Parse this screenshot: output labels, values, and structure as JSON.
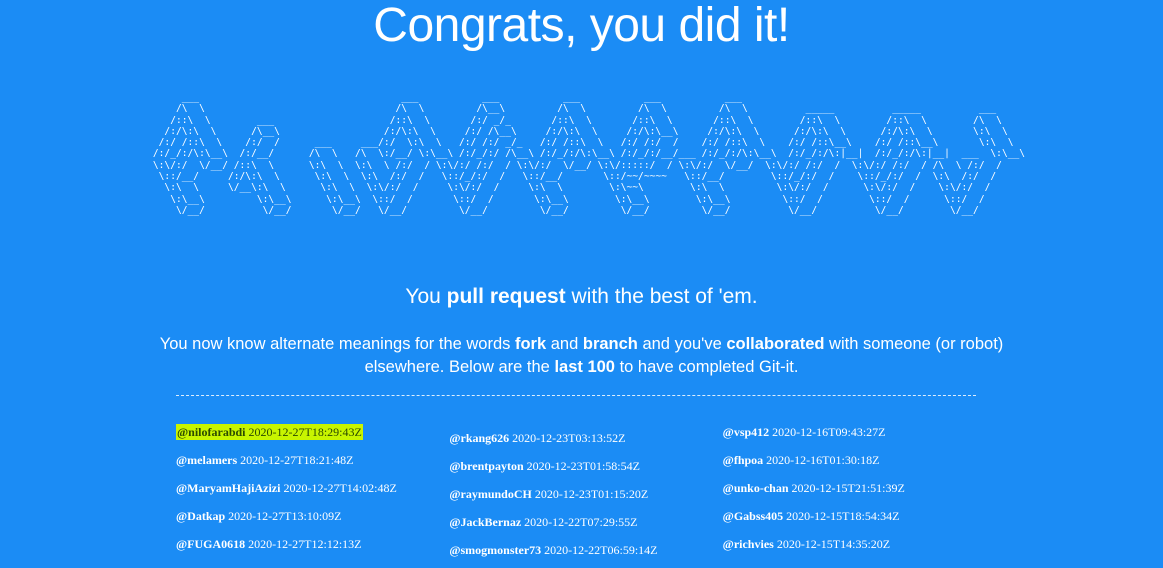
{
  "page": {
    "title": "Congrats, you did it!",
    "ascii_art": "          ___                                   ___           ___           ___           ___           ___                                          \n         /\\  \\                                 /\\  \\         /\\__\\         /\\  \\         /\\  \\         /\\  \\          _____          _____          ___   \n        /::\\  \\        ___                    /::\\  \\       /:/ _/_       /::\\  \\       /::\\  \\       /::\\  \\        /::\\  \\        /::\\  \\        /\\  \\  \n       /:/\\:\\  \\      /\\__\\                  /:/\\:\\  \\     /:/ /\\__\\     /:/\\:\\  \\     /:/\\:\\__\\     /:/\\:\\  \\      /:/\\:\\  \\      /:/\\:\\  \\       \\:\\  \\ \n      /:/ /::\\  \\    /:/  /      ___     ___/:/  \\:\\  \\   /:/ /:/ _/_   /:/ /::\\  \\   /:/ /:/  /    /:/ /::\\  \\    /:/ /::\\__\\    /:/ /::\\__\\       \\:\\  \\\n     /:/_/:/\\:\\__\\  /:/__/      /\\  \\   /\\  \\:/__/ \\:\\__\\ /:/_/:/ /\\__\\ /:/_/:/\\:\\__\\ /:/_/:/__/___ /:/_/:/\\:\\__\\  /:/_/:/\\:|__|  /:/_/:/\\:|__|  ___  \\:\\__\\\n     \\:\\/:/  \\/__/ /::\\  \\      \\:\\  \\  \\:\\  \\ /:/  / \\:\\/:/ /:/  / \\:\\/:/  \\/__/ \\:\\/:::::/  / \\:\\/:/  \\/__/  \\:\\/:/ /:/  /  \\:\\/:/ /:/  / /\\  \\ /:/  /\n      \\::/__/     /:/\\:\\  \\      \\:\\  \\  \\:\\  /:/  /   \\::/_/:/  /   \\::/__/       \\::/~~/~~~~   \\::/__/        \\::/_/:/  /    \\::/_/:/  /  \\:\\  /:/  / \n       \\:\\  \\     \\/__\\:\\  \\      \\:\\  \\  \\:\\/:/  /     \\:\\/:/  /     \\:\\  \\        \\:\\~~\\        \\:\\  \\         \\:\\/:/  /      \\:\\/:/  /    \\:\\/:/  /  \n        \\:\\__\\         \\:\\__\\      \\:\\__\\  \\::/  /       \\::/  /       \\:\\__\\        \\:\\__\\        \\:\\__\\         \\::/  /        \\::/  /      \\::/  /   \n         \\/__/          \\/__/       \\/__/   \\/__/         \\/__/         \\/__/         \\/__/         \\/__/          \\/__/          \\/__/        \\/__/    ",
    "tagline": {
      "pre": "You ",
      "bold": "pull request",
      "post": " with the best of 'em."
    },
    "intro": {
      "t1": "You now know alternate meanings for the words ",
      "b1": "fork",
      "t2": " and ",
      "b2": "branch",
      "t3": " and you've ",
      "b3": "collaborated",
      "t4": " with someone (or robot) elsewhere. Below are the ",
      "b4": "last 100",
      "t5": " to have completed Git-it."
    }
  },
  "completers": {
    "columns": [
      [
        {
          "user": "@nilofarabdi",
          "time": " 2020-12-27T18:29:43Z"
        },
        {
          "user": "@melamers",
          "time": " 2020-12-27T18:21:48Z"
        },
        {
          "user": "@MaryamHajiAzizi",
          "time": " 2020-12-27T14:02:48Z"
        },
        {
          "user": "@Datkap",
          "time": " 2020-12-27T13:10:09Z"
        },
        {
          "user": "@FUGA0618",
          "time": " 2020-12-27T12:12:13Z"
        }
      ],
      [
        {
          "user": "@rkang626",
          "time": " 2020-12-23T03:13:52Z"
        },
        {
          "user": "@brentpayton",
          "time": " 2020-12-23T01:58:54Z"
        },
        {
          "user": "@raymundoCH",
          "time": " 2020-12-23T01:15:20Z"
        },
        {
          "user": "@JackBernaz",
          "time": " 2020-12-22T07:29:55Z"
        },
        {
          "user": "@smogmonster73",
          "time": " 2020-12-22T06:59:14Z"
        }
      ],
      [
        {
          "user": "@vsp412",
          "time": " 2020-12-16T09:43:27Z"
        },
        {
          "user": "@fhpoa",
          "time": " 2020-12-16T01:30:18Z"
        },
        {
          "user": "@unko-chan",
          "time": " 2020-12-15T21:51:39Z"
        },
        {
          "user": "@Gabss405",
          "time": " 2020-12-15T18:54:34Z"
        },
        {
          "user": "@richvies",
          "time": " 2020-12-15T14:35:20Z"
        }
      ]
    ],
    "highlight_color": "#c8f500"
  },
  "colors": {
    "background": "#1b8cf5",
    "text": "#ffffff"
  }
}
